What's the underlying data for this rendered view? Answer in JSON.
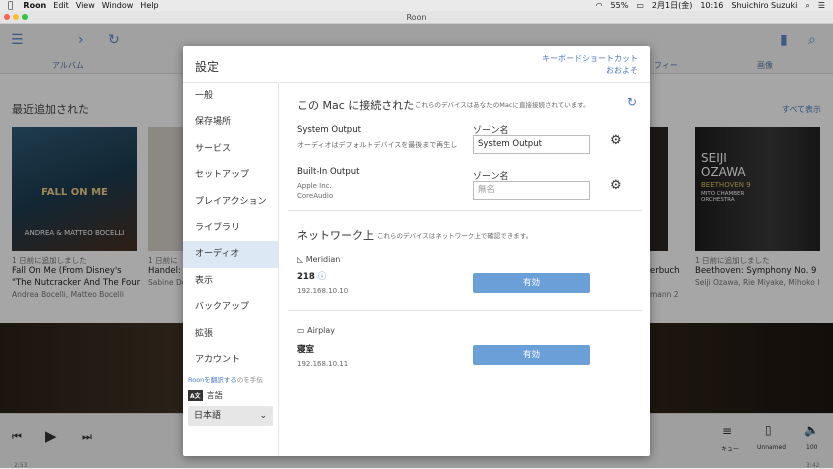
{
  "menubar": {
    "apple": "",
    "app": "Roon",
    "items": [
      "Edit",
      "View",
      "Window",
      "Help"
    ],
    "battery": "55%",
    "date": "2月1日(金)",
    "time": "10:16",
    "user": "Shuichiro Suzuki"
  },
  "window": {
    "title": "Roon"
  },
  "tabs": [
    "アルバム",
    "フィー",
    "画像"
  ],
  "section": {
    "title": "最近追加された",
    "see_all": "すべて表示"
  },
  "albums": [
    {
      "cover_title": "FALL ON ME",
      "cover_artist": "ANDREA & MATTEO BOCELLI",
      "date": "1 日前に追加しました",
      "title1": "Fall On Me (From Disney's",
      "title2": "\"The Nutcracker And The Four",
      "artist": "Andrea Bocelli, Matteo Bocelli"
    },
    {
      "date": "1 日前に",
      "title1": "Handel:",
      "artist": "Sabine De"
    },
    {
      "date": "",
      "title1": "erbuch",
      "artist": "mann 2"
    },
    {
      "cover_title": "SEIJI OZAWA",
      "cover_sub": "BEETHOVEN 9",
      "cover_orch": "MITO CHAMBER ORCHESTRA",
      "date": "1 日前に追加しました",
      "title1": "Beethoven: Symphony No. 9",
      "artist": "Seiji Ozawa, Rie Miyake, Mihoko I"
    }
  ],
  "player": {
    "queue": "キュー",
    "zone": "Unnamed",
    "volume": "100",
    "time_left": "2:53",
    "time_right": "3:42"
  },
  "dialog": {
    "title": "設定",
    "keyboard_link1": "キーボードショートカット",
    "keyboard_link2": "おおよそ",
    "sidebar": [
      "一般",
      "保存場所",
      "サービス",
      "セットアップ",
      "プレイアクション",
      "ライブラリ",
      "オーディオ",
      "表示",
      "バックアップ",
      "拡張",
      "アカウント"
    ],
    "selected": "オーディオ",
    "translate_link": "Roonを翻訳する",
    "translate_rest": "のを手伝",
    "lang_label": "言語",
    "lang_value": "日本語",
    "mac_title": "この Mac に接続された",
    "mac_sub": "これらのデバイスはあなたのMacに直接接続されています。",
    "dev1_name": "System Output",
    "dev1_sub": "オーディオはデフォルトデバイスを最後まで再生し",
    "dev1_zone_label": "ゾーン名",
    "dev1_zone": "System Output",
    "dev2_name": "Built-In Output",
    "dev2_sub1": "Apple Inc.",
    "dev2_sub2": "CoreAudio",
    "dev2_zone_label": "ゾーン名",
    "dev2_zone_placeholder": "無名",
    "net_title": "ネットワーク上",
    "net_sub": "これらのデバイスはネットワーク上で確認できます。",
    "net1_brand": "Meridian",
    "net1_name": "218",
    "net1_ip": "192.168.10.10",
    "net1_btn": "有効",
    "net2_brand": "Airplay",
    "net2_name": "寝室",
    "net2_ip": "192.168.10.11",
    "net2_btn": "有効"
  }
}
